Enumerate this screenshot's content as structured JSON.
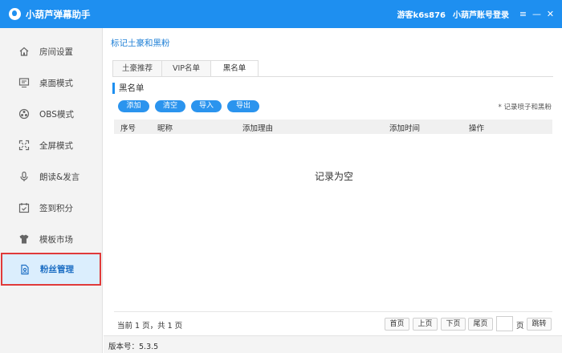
{
  "app": {
    "title": "小葫芦弹幕助手",
    "guest": "游客k6s876",
    "login": "小葫芦账号登录",
    "menu_glyph": "≡",
    "minimize_glyph": "—",
    "close_glyph": "✕"
  },
  "sidebar": {
    "items": [
      {
        "label": "房间设置",
        "icon": "home-icon"
      },
      {
        "label": "桌面模式",
        "icon": "monitor-icon"
      },
      {
        "label": "OBS模式",
        "icon": "obs-icon"
      },
      {
        "label": "全屏模式",
        "icon": "fullscreen-icon"
      },
      {
        "label": "朗读&发言",
        "icon": "microphone-icon"
      },
      {
        "label": "签到积分",
        "icon": "calendar-check-icon"
      },
      {
        "label": "模板市场",
        "icon": "shirt-icon"
      },
      {
        "label": "粉丝管理",
        "icon": "fan-card-icon"
      }
    ],
    "active_index": 7
  },
  "main": {
    "title": "标记土豪和黑粉",
    "tabs": [
      {
        "label": "土豪推荐"
      },
      {
        "label": "VIP名单"
      },
      {
        "label": "黑名单"
      }
    ],
    "active_tab": 2,
    "section_title": "黑名单",
    "buttons": {
      "add": "添加",
      "clear": "清空",
      "import": "导入",
      "export": "导出"
    },
    "note": "* 记录喷子和黑粉",
    "columns": {
      "index": "序号",
      "nickname": "昵称",
      "reason": "添加理由",
      "time": "添加时间",
      "action": "操作"
    },
    "empty_text": "记录为空",
    "pager": {
      "info": "当前 1 页，共 1 页",
      "first": "首页",
      "prev": "上页",
      "next": "下页",
      "last": "尾页",
      "page_value": "",
      "page_unit": "页",
      "jump": "跳转"
    }
  },
  "status": {
    "version": "版本号：5.3.5"
  },
  "colors": {
    "accent": "#1e8ff0",
    "highlight_border": "#e03a3a",
    "active_bg": "#dbeefd"
  }
}
